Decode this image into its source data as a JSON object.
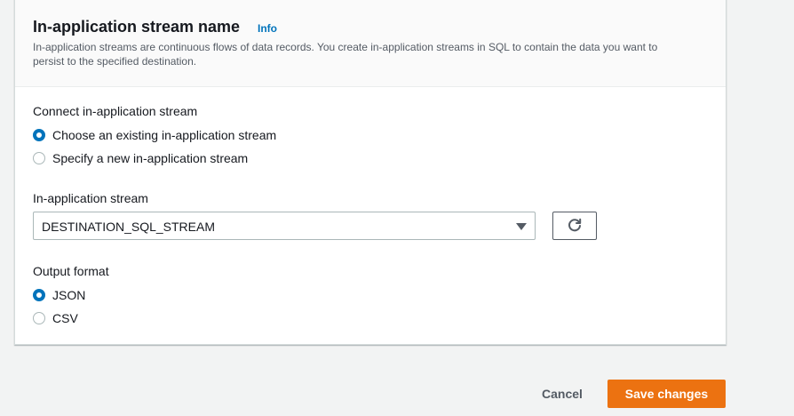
{
  "panel": {
    "title": "In-application stream name",
    "info_link": "Info",
    "description": "In-application streams are continuous flows of data records. You create in-application streams in SQL to contain the data you want to persist to the specified destination."
  },
  "connect": {
    "label": "Connect in-application stream",
    "options": [
      {
        "label": "Choose an existing in-application stream",
        "checked": true
      },
      {
        "label": "Specify a new in-application stream",
        "checked": false
      }
    ]
  },
  "stream_select": {
    "label": "In-application stream",
    "value": "DESTINATION_SQL_STREAM",
    "refresh_icon": "refresh-icon"
  },
  "output_format": {
    "label": "Output format",
    "options": [
      {
        "label": "JSON",
        "checked": true
      },
      {
        "label": "CSV",
        "checked": false
      }
    ]
  },
  "footer": {
    "cancel_label": "Cancel",
    "save_label": "Save changes"
  },
  "colors": {
    "accent": "#0073bb",
    "primary_button": "#ec7211",
    "background": "#f2f3f3"
  }
}
